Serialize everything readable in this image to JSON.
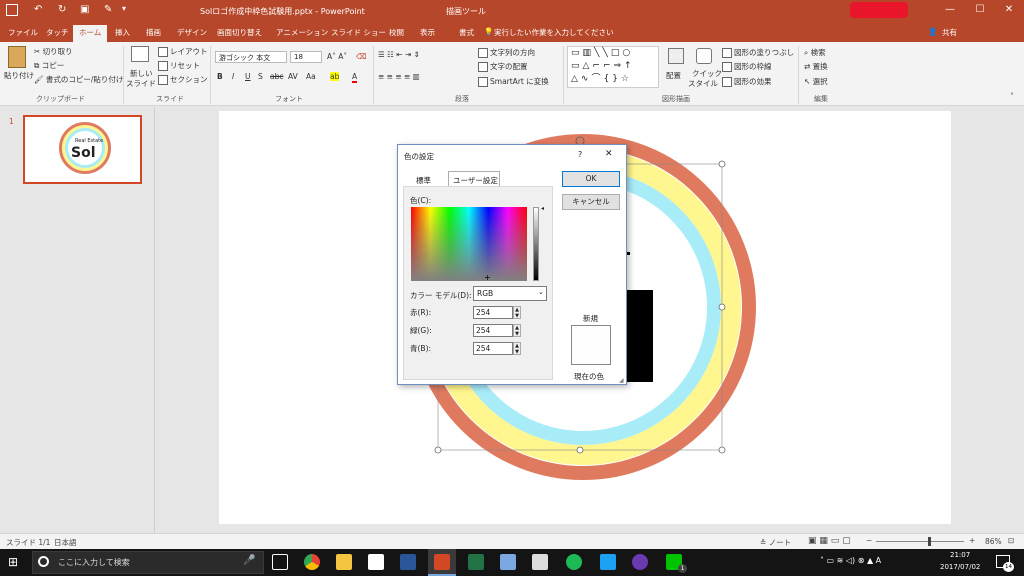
{
  "titlebar": {
    "doc_title": "Solロゴ作成中枠色試験用.pptx - PowerPoint",
    "context_tab_group": "描画ツール",
    "min": "—",
    "max": "☐",
    "close": "✕"
  },
  "tabs": [
    "ファイル",
    "タッチ",
    "ホーム",
    "挿入",
    "描画",
    "デザイン",
    "画面切り替え",
    "アニメーション",
    "スライド ショー",
    "校閲",
    "表示",
    "書式"
  ],
  "tell_me": "実行したい作業を入力してください",
  "share": "共有",
  "ribbon": {
    "clipboard": {
      "paste": "貼り付け",
      "cut": "切り取り",
      "copy": "コピー",
      "format_painter": "書式のコピー/貼り付け",
      "label": "クリップボード"
    },
    "slides": {
      "new_slide": "新しい",
      "new_slide2": "スライド",
      "layout": "レイアウト",
      "reset": "リセット",
      "section": "セクション",
      "label": "スライド"
    },
    "font": {
      "name": "游ゴシック 本文",
      "size": "18",
      "label": "フォント"
    },
    "paragraph": {
      "text_direction": "文字列の方向",
      "align_text": "文字の配置",
      "smartart": "SmartArt に変換",
      "label": "段落"
    },
    "drawing": {
      "arrange": "配置",
      "quick_styles": "クイック",
      "quick_styles2": "スタイル",
      "fill": "図形の塗りつぶし",
      "outline": "図形の枠線",
      "effects": "図形の効果",
      "label": "図形描画"
    },
    "editing": {
      "find": "検索",
      "replace": "置換",
      "select": "選択",
      "label": "編集"
    }
  },
  "slide_number": "1",
  "thumb_text": "Sol",
  "thumb_small": "Real Estate",
  "dialog": {
    "title": "色の設定",
    "help": "?",
    "tab_standard": "標準",
    "tab_custom": "ユーザー設定",
    "color_label": "色(C):",
    "model_label": "カラー モデル(D):",
    "model_value": "RGB",
    "red_label": "赤(R):",
    "green_label": "緑(G):",
    "blue_label": "青(B):",
    "red": "254",
    "green": "254",
    "blue": "254",
    "ok": "OK",
    "cancel": "キャンセル",
    "new_label": "新規",
    "current_label": "現在の色"
  },
  "status": {
    "slide": "スライド 1/1",
    "language": "日本語",
    "notes": "ノート",
    "zoom": "86%"
  },
  "taskbar": {
    "search_placeholder": "ここに入力して検索",
    "time": "21:07",
    "date": "2017/07/02",
    "notif_count": "14",
    "line_badge": "1"
  },
  "colors": {
    "accent": "#b7472a",
    "ring_orange": "#e07a5f",
    "ring_yellow": "#fff68f",
    "ring_cyan": "#a8ecf8"
  }
}
